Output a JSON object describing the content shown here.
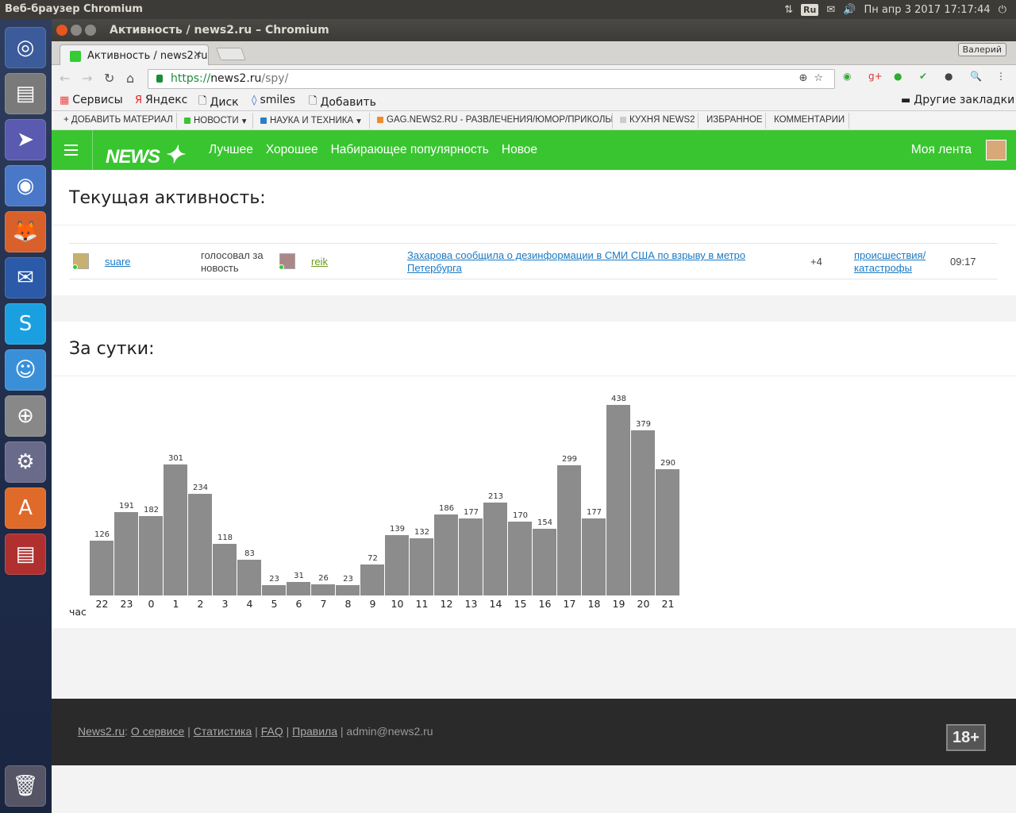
{
  "system": {
    "app_title": "Веб-браузер Chromium",
    "lang": "Ru",
    "clock": "Пн апр  3 2017 17:17:44"
  },
  "window": {
    "title": "Активность / news2.ru – Chromium",
    "tab_title": "Активность / news2.ru",
    "user": "Валерий"
  },
  "omnibox": {
    "scheme": "https://",
    "host": "news2.ru",
    "path": "/spy/"
  },
  "bookmarks": {
    "items": [
      "Сервисы",
      "Яндекс",
      "Диск",
      "smiles",
      "Добавить"
    ],
    "other": "Другие закладки"
  },
  "sitenav": {
    "items": [
      {
        "label": "+ ДОБАВИТЬ МАТЕРИАЛ",
        "color": ""
      },
      {
        "label": "НОВОСТИ",
        "color": "#39c530"
      },
      {
        "label": "НАУКА И ТЕХНИКА",
        "color": "#2a7fc4"
      },
      {
        "label": "GAG.NEWS2.RU - РАЗВЛЕЧЕНИЯ/ЮМОР/ПРИКОЛЫ",
        "color": "#f08a30"
      },
      {
        "label": "КУХНЯ NEWS2",
        "color": "#cccccc"
      },
      {
        "label": "ИЗБРАННОЕ",
        "color": ""
      },
      {
        "label": "КОММЕНТАРИИ",
        "color": ""
      }
    ]
  },
  "header": {
    "logo": "NEWS",
    "menu": [
      "Лучшее",
      "Хорошее",
      "Набирающее популярность",
      "Новое"
    ],
    "my_feed": "Моя лента",
    "brand_color": "#39c530"
  },
  "activity": {
    "title": "Текущая активность:",
    "row": {
      "user": "suare",
      "action": "голосовал за новость",
      "author": "reik",
      "news": "Захарова сообщила о дезинформации в СМИ США по взрыву в метро Петербурга",
      "votes": "+4",
      "category": "происшествия/катастрофы",
      "time": "09:17"
    }
  },
  "daily": {
    "title": "За сутки:",
    "x_prefix": "час"
  },
  "chart_data": {
    "type": "bar",
    "categories": [
      "22",
      "23",
      "0",
      "1",
      "2",
      "3",
      "4",
      "5",
      "6",
      "7",
      "8",
      "9",
      "10",
      "11",
      "12",
      "13",
      "14",
      "15",
      "16",
      "17",
      "18",
      "19",
      "20",
      "21"
    ],
    "values": [
      126,
      191,
      182,
      301,
      234,
      118,
      83,
      23,
      31,
      26,
      23,
      72,
      139,
      132,
      186,
      177,
      213,
      170,
      154,
      299,
      177,
      438,
      379,
      290
    ],
    "bar_color": "#8c8c8c"
  },
  "footer": {
    "site": "News2.ru",
    "links": [
      "О сервисе",
      "Статистика",
      "FAQ",
      "Правила"
    ],
    "email": "admin@news2.ru",
    "age": "18+"
  }
}
